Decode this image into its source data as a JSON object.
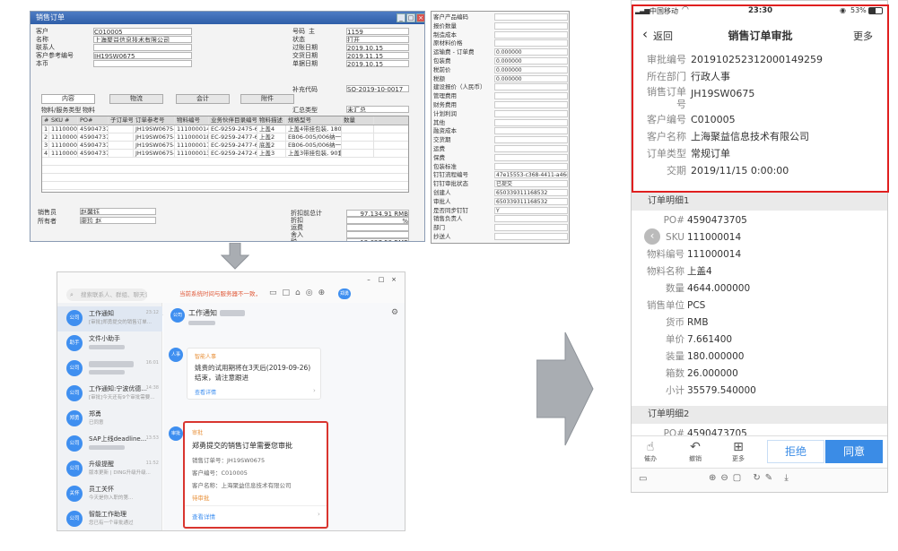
{
  "sap": {
    "window_title": "销售订单",
    "header_left": [
      {
        "label": "客户",
        "value": "C010005"
      },
      {
        "label": "名称",
        "value": "上海聚益信息技术有限公司"
      },
      {
        "label": "联系人",
        "value": ""
      },
      {
        "label": "客户参考编号",
        "value": "JH19SW0675"
      },
      {
        "label": "本币",
        "value": ""
      }
    ],
    "header_right": [
      {
        "label": "号码",
        "prefix": "主",
        "value": "1159"
      },
      {
        "label": "状态",
        "value": "打开"
      },
      {
        "label": "过账日期",
        "value": "2019.10.15"
      },
      {
        "label": "交货日期",
        "value": "2019.11.15"
      },
      {
        "label": "单据日期",
        "value": "2019.10.15"
      }
    ],
    "extra_code_label": "补充代码",
    "extra_code_value": "SO-2019-10-0017",
    "tabs": [
      "内容",
      "物流",
      "会计",
      "附件"
    ],
    "item_type_label": "物料/服务类型",
    "item_type_value": "物料",
    "summary_label": "汇总类型",
    "summary_value": "未汇总",
    "grid_headers": [
      "#",
      "SKU #",
      "PO#",
      "子订单号",
      "订单参考号",
      "物料编号",
      "业务伙伴目录编号",
      "物料描述",
      "规格型号",
      "数量"
    ],
    "grid_rows": [
      [
        "1",
        "111000014",
        "4590473705",
        "",
        "JH19SW0675-1",
        "111000014",
        "EC-9259-2475-6",
        "上盖4",
        "上盖4带挂包装, 180套/箱",
        ""
      ],
      [
        "2",
        "111000018",
        "4590473705",
        "",
        "JH19SW0675-2",
        "111000018",
        "EC-9259-2477-6",
        "上盖2",
        "EB06-005/006纳一起包装",
        ""
      ],
      [
        "3",
        "111000017",
        "4590473705",
        "",
        "JH19SW0675-3",
        "111000017",
        "EC-9259-2477-6",
        "底盖2",
        "EB06-005/006纳一起包装",
        ""
      ],
      [
        "4",
        "111000013",
        "4590473705",
        "",
        "JH19SW0675-4",
        "111000013",
        "EC-9259-2472-6",
        "上盖3",
        "上盖3带挂包装, 90套/箱",
        ""
      ]
    ],
    "sales_person_label": "销售员",
    "sales_person_value": "赵馨钰",
    "owner_label": "所有者",
    "owner_value": "廖珍 赵",
    "totals": [
      {
        "label": "折扣前总计",
        "value": "97,134.91 RMB"
      },
      {
        "label": "折扣",
        "value": "%"
      },
      {
        "label": "运费",
        "value": ""
      },
      {
        "label": "舍入",
        "value": ""
      },
      {
        "label": "税",
        "value": "12,627.53 RMB"
      }
    ],
    "right_panel": [
      {
        "label": "客户产品编码",
        "value": ""
      },
      {
        "label": "报价数量",
        "value": ""
      },
      {
        "label": "制造成本",
        "value": ""
      },
      {
        "label": "原材料价格",
        "value": ""
      },
      {
        "label": "运输费 - 订单费",
        "value": "0.000000"
      },
      {
        "label": "包装费",
        "value": "0.000000"
      },
      {
        "label": "税前价",
        "value": "0.000000"
      },
      {
        "label": "税额",
        "value": "0.000000"
      },
      {
        "label": "建设报价（人民币）",
        "value": ""
      },
      {
        "label": "管理费用",
        "value": ""
      },
      {
        "label": "财务费用",
        "value": ""
      },
      {
        "label": "计划利润",
        "value": ""
      },
      {
        "label": "其他",
        "value": ""
      },
      {
        "label": "融资成本",
        "value": ""
      },
      {
        "label": "交货期",
        "value": ""
      },
      {
        "label": "运费",
        "value": ""
      },
      {
        "label": "保费",
        "value": ""
      },
      {
        "label": "包装标准",
        "value": ""
      },
      {
        "label": "钉钉流程编号",
        "value": "47e15553-c368-4411-a46d-cdd1401f6b9"
      },
      {
        "label": "钉钉审批状态",
        "value": "已提交"
      },
      {
        "label": "创建人",
        "value": "650339311168532"
      },
      {
        "label": "审批人",
        "value": "650339311168532"
      },
      {
        "label": "是否同步钉钉",
        "value": "Y"
      },
      {
        "label": "销售负责人",
        "value": ""
      },
      {
        "label": "部门",
        "value": ""
      },
      {
        "label": "抄送人",
        "value": ""
      }
    ]
  },
  "chat": {
    "search_placeholder": "搜索联系人、群组、聊天记录等",
    "notice": "当前系统时间与服务器不一致，请及时调整",
    "list": [
      {
        "avatar": "公司",
        "title": "工作通知",
        "sub": "[审批]郑勇提交的销售订单...",
        "time": "23:12"
      },
      {
        "avatar": "助手",
        "title": "文件小助手",
        "sub": "",
        "time": ""
      },
      {
        "avatar": "公司",
        "title": "",
        "sub": "",
        "time": "16:01"
      },
      {
        "avatar": "公司",
        "title": "工作通知:宁波优德...",
        "sub": "[审批]今天还有9个审批需要...",
        "time": "14:38"
      },
      {
        "avatar": "郑勇",
        "title": "郑勇",
        "sub": "已同意",
        "time": ""
      },
      {
        "avatar": "公司",
        "title": "SAP上线deadline...",
        "sub": "",
        "time": "13:53"
      },
      {
        "avatar": "公司",
        "title": "升级提醒",
        "sub": "版本更新 | DING升级升级...",
        "time": "11:52"
      },
      {
        "avatar": "关怀",
        "title": "员工关怀",
        "sub": "今天是你入职的第...",
        "time": ""
      },
      {
        "avatar": "公司",
        "title": "智能工作助理",
        "sub": "您已有一个审批通过",
        "time": ""
      }
    ],
    "main_title": "工作通知",
    "card1": {
      "tag": "智能人事",
      "text": "姚贵的试用期将在3天后(2019-09-26)结束，请注意跟进",
      "link": "查看详情"
    },
    "card2": {
      "tag": "审批",
      "title": "郑勇提交的销售订单需要您审批",
      "lines": [
        "销售订单号：JH19SW0675",
        "客户编号：C010005",
        "客户名称：上海聚益信息技术有限公司"
      ],
      "status": "待审批",
      "link": "查看详情"
    }
  },
  "phone": {
    "carrier": "中国移动",
    "time": "23:30",
    "battery": "53%",
    "back_label": "返回",
    "title": "销售订单审批",
    "more_label": "更多",
    "fields": [
      {
        "label": "审批编号",
        "value": "201910252312000149259"
      },
      {
        "label": "所在部门",
        "value": "行政人事"
      },
      {
        "label": "销售订单号",
        "value": "JH19SW0675"
      },
      {
        "label": "客户编号",
        "value": "C010005"
      },
      {
        "label": "客户名称",
        "value": "上海聚益信息技术有限公司"
      },
      {
        "label": "订单类型",
        "value": "常规订单"
      },
      {
        "label": "交期",
        "value": "2019/11/15 0:00:00"
      }
    ],
    "detail1_title": "订单明细1",
    "detail1": [
      {
        "label": "PO#",
        "value": "4590473705"
      },
      {
        "label": "SKU",
        "value": "111000014"
      },
      {
        "label": "物料编号",
        "value": "111000014"
      },
      {
        "label": "物料名称",
        "value": "上盖4"
      },
      {
        "label": "数量",
        "value": "4644.000000"
      },
      {
        "label": "销售单位",
        "value": "PCS"
      },
      {
        "label": "货币",
        "value": "RMB"
      },
      {
        "label": "单价",
        "value": "7.661400"
      },
      {
        "label": "装量",
        "value": "180.000000"
      },
      {
        "label": "箱数",
        "value": "26.000000"
      },
      {
        "label": "小计",
        "value": "35579.540000"
      }
    ],
    "detail2_title": "订单明细2",
    "detail2_first": "4590473705",
    "detail2_first_label": "PO#",
    "actions": [
      {
        "icon": "催",
        "label": "催办"
      },
      {
        "icon": "撤",
        "label": "撤销"
      },
      {
        "icon": "多",
        "label": "更多"
      }
    ],
    "reject_label": "拒绝",
    "approve_label": "同意",
    "accent": "#3b8ce6"
  }
}
